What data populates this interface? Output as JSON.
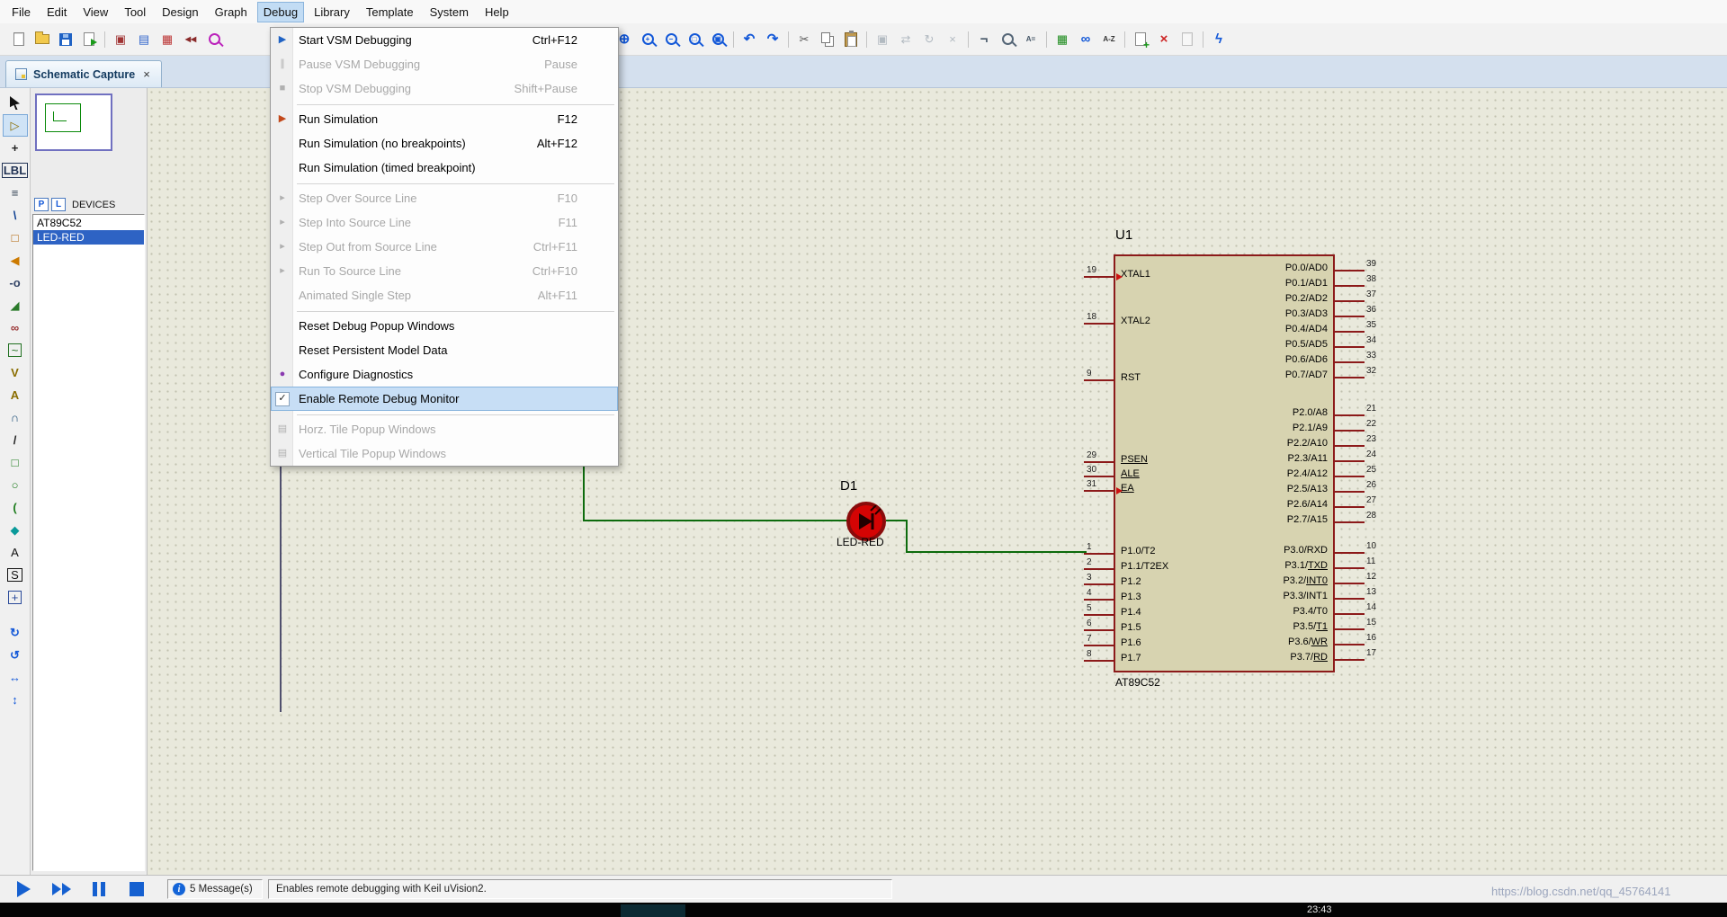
{
  "menu_bar": {
    "items": [
      {
        "label": "File",
        "name": "menu-file"
      },
      {
        "label": "Edit",
        "name": "menu-edit"
      },
      {
        "label": "View",
        "name": "menu-view"
      },
      {
        "label": "Tool",
        "name": "menu-tool"
      },
      {
        "label": "Design",
        "name": "menu-design"
      },
      {
        "label": "Graph",
        "name": "menu-graph"
      },
      {
        "label": "Debug",
        "name": "menu-debug",
        "active": true
      },
      {
        "label": "Library",
        "name": "menu-library"
      },
      {
        "label": "Template",
        "name": "menu-template"
      },
      {
        "label": "System",
        "name": "menu-system"
      },
      {
        "label": "Help",
        "name": "menu-help"
      }
    ]
  },
  "toolbar": {
    "icons": [
      {
        "name": "new-file-icon",
        "kind": "k-page",
        "glyph": ""
      },
      {
        "name": "open-file-icon",
        "kind": "k-folder",
        "glyph": ""
      },
      {
        "name": "save-file-icon",
        "kind": "k-floppy",
        "glyph": ""
      },
      {
        "name": "import-file-icon",
        "kind": "k-page-import",
        "glyph": ""
      },
      {
        "name": "toolbar-separator",
        "sep": true
      },
      {
        "name": "app-window-icon",
        "glyph": "▣",
        "color": "#a03333"
      },
      {
        "name": "tile-windows-icon",
        "glyph": "▤",
        "color": "#3366cc"
      },
      {
        "name": "grid-toggle-icon",
        "glyph": "▦",
        "color": "#bb3333"
      },
      {
        "name": "navigate-back-icon",
        "glyph": "◀◀",
        "color": "#8a2a2a",
        "kind": "k-tiny"
      },
      {
        "name": "zoom-tool-icon",
        "kind": "k-mag",
        "glyph": "",
        "color": "#bb22bb"
      },
      {
        "name": "toolbar-spacer",
        "spacer": true
      },
      {
        "name": "center-at-cursor-icon",
        "glyph": "+",
        "color": "#c89a10",
        "kind": "k-bold"
      },
      {
        "name": "pan-view-icon",
        "glyph": "⊕",
        "color": "#1358d8",
        "kind": "k-bold"
      },
      {
        "name": "zoom-in-icon",
        "kind": "k-mag",
        "glyph": "+",
        "color": "#1358d8"
      },
      {
        "name": "zoom-out-icon",
        "kind": "k-mag",
        "glyph": "−",
        "color": "#1358d8"
      },
      {
        "name": "zoom-area-icon",
        "kind": "k-mag",
        "glyph": "□",
        "color": "#1358d8"
      },
      {
        "name": "zoom-all-icon",
        "kind": "k-mag",
        "glyph": "▣",
        "color": "#1358d8"
      },
      {
        "name": "toolbar-separator",
        "sep": true
      },
      {
        "name": "undo-icon",
        "glyph": "↶",
        "color": "#1358d8",
        "kind": "k-bold"
      },
      {
        "name": "redo-icon",
        "glyph": "↷",
        "color": "#1358d8",
        "kind": "k-bold"
      },
      {
        "name": "toolbar-separator",
        "sep": true
      },
      {
        "name": "cut-icon",
        "glyph": "✂",
        "color": "#555555"
      },
      {
        "name": "copy-icon",
        "kind": "k-copy",
        "glyph": ""
      },
      {
        "name": "paste-icon",
        "kind": "k-paste",
        "glyph": ""
      },
      {
        "name": "toolbar-separator",
        "sep": true
      },
      {
        "name": "block-copy-icon",
        "glyph": "▣",
        "color": "#667788",
        "disabled": true
      },
      {
        "name": "block-move-icon",
        "glyph": "⇄",
        "color": "#667788",
        "disabled": true
      },
      {
        "name": "block-rotate-icon",
        "glyph": "↻",
        "color": "#667788",
        "disabled": true
      },
      {
        "name": "block-delete-icon",
        "glyph": "×",
        "color": "#667788",
        "disabled": true
      },
      {
        "name": "toolbar-separator",
        "sep": true
      },
      {
        "name": "wire-autorouter-icon",
        "glyph": "¬",
        "color": "#445566",
        "kind": "k-bold"
      },
      {
        "name": "search-tag-icon",
        "kind": "k-mag",
        "glyph": "",
        "color": "#556677"
      },
      {
        "name": "property-assignment-icon",
        "glyph": "A=",
        "color": "#445566",
        "kind": "k-tiny"
      },
      {
        "name": "toolbar-separator",
        "sep": true
      },
      {
        "name": "design-grid-icon",
        "glyph": "▦",
        "color": "#1a8a1a"
      },
      {
        "name": "find-component-icon",
        "glyph": "∞",
        "color": "#1358d8",
        "kind": "k-bold"
      },
      {
        "name": "sort-az-icon",
        "glyph": "A-Z",
        "color": "#333333",
        "kind": "k-tiny"
      },
      {
        "name": "toolbar-separator",
        "sep": true
      },
      {
        "name": "new-sheet-icon",
        "kind": "k-page-plus",
        "glyph": ""
      },
      {
        "name": "remove-sheet-icon",
        "glyph": "×",
        "color": "#cc2222",
        "kind": "k-bold"
      },
      {
        "name": "goto-sheet-icon",
        "kind": "k-page",
        "glyph": "",
        "disabled": true
      },
      {
        "name": "toolbar-separator",
        "sep": true
      },
      {
        "name": "electrical-check-icon",
        "glyph": "ϟ",
        "color": "#1358d8",
        "kind": "k-bold"
      }
    ]
  },
  "tab_bar": {
    "label": "Schematic Capture",
    "close_glyph": "×"
  },
  "side_toolbar": {
    "icons": [
      {
        "name": "selection-mode-icon",
        "kind": "k-cursor",
        "glyph": ""
      },
      {
        "name": "component-mode-icon",
        "glyph": "▷",
        "color": "#8a6d00",
        "selected": true
      },
      {
        "name": "junction-dot-mode-icon",
        "glyph": "+",
        "color": "#222222",
        "kind": "k-bold"
      },
      {
        "name": "wire-label-mode-icon",
        "glyph": "LBL",
        "color": "#223355",
        "kind": "k-lbl"
      },
      {
        "name": "text-script-mode-icon",
        "glyph": "≡",
        "color": "#334455"
      },
      {
        "name": "buses-mode-icon",
        "glyph": "\\",
        "color": "#0a3d91",
        "kind": "k-bold"
      },
      {
        "name": "subcircuit-mode-icon",
        "glyph": "□",
        "color": "#b06000"
      },
      {
        "name": "terminal-mode-icon",
        "glyph": "◀",
        "color": "#cc7a00"
      },
      {
        "name": "device-pin-mode-icon",
        "glyph": "-o",
        "color": "#334466",
        "kind": "k-tiny"
      },
      {
        "name": "graph-mode-icon",
        "glyph": "◢",
        "color": "#2a7a2a"
      },
      {
        "name": "tape-recorder-mode-icon",
        "glyph": "∞",
        "color": "#993333",
        "kind": "k-bold"
      },
      {
        "name": "generator-mode-icon",
        "glyph": "~",
        "color": "#207020",
        "kind": "k-boxed"
      },
      {
        "name": "voltage-probe-mode-icon",
        "glyph": "V",
        "color": "#8a6d00",
        "kind": "k-bold"
      },
      {
        "name": "current-probe-mode-icon",
        "glyph": "A",
        "color": "#8a6d00",
        "kind": "k-bold"
      },
      {
        "name": "virtual-instruments-mode-icon",
        "glyph": "∩",
        "color": "#20507a",
        "kind": "k-bold"
      },
      {
        "name": "2d-line-mode-icon",
        "glyph": "/",
        "color": "#222222",
        "kind": "k-bold"
      },
      {
        "name": "2d-box-mode-icon",
        "glyph": "□",
        "color": "#1a7a1a"
      },
      {
        "name": "2d-circle-mode-icon",
        "glyph": "○",
        "color": "#1a7a1a"
      },
      {
        "name": "2d-arc-mode-icon",
        "glyph": "(",
        "color": "#1a7a1a",
        "kind": "k-bold"
      },
      {
        "name": "2d-path-mode-icon",
        "glyph": "◆",
        "color": "#0a9a9a"
      },
      {
        "name": "2d-text-mode-icon",
        "glyph": "A",
        "color": "#111111"
      },
      {
        "name": "2d-symbol-mode-icon",
        "glyph": "S",
        "color": "#111111",
        "kind": "k-boxed"
      },
      {
        "name": "2d-marker-mode-icon",
        "glyph": "+",
        "color": "#2a4a9a",
        "kind": "k-boxed"
      },
      {
        "name": "mode-toolbar-gap",
        "gap": true
      },
      {
        "name": "rotate-clockwise-icon",
        "glyph": "↻",
        "color": "#1358d8",
        "kind": "k-bold"
      },
      {
        "name": "rotate-anticlockwise-icon",
        "glyph": "↺",
        "color": "#1358d8",
        "kind": "k-bold"
      },
      {
        "name": "x-mirror-icon",
        "glyph": "↔",
        "color": "#1358d8",
        "kind": "k-bold"
      },
      {
        "name": "y-mirror-icon",
        "glyph": "↕",
        "color": "#1358d8",
        "kind": "k-bold"
      }
    ]
  },
  "left_panel": {
    "devices": {
      "p_button": "P",
      "l_button": "L",
      "title": "DEVICES",
      "items": [
        {
          "name": "AT89C52"
        },
        {
          "name": "LED-RED",
          "selected": true
        }
      ]
    }
  },
  "debug_menu": {
    "items": [
      {
        "name": "menu-item-start-vsm-debugging",
        "label": "Start VSM Debugging",
        "shortcut": "Ctrl+F12",
        "gicon": "▶",
        "gcls": "mi-play"
      },
      {
        "name": "menu-item-pause-vsm-debugging",
        "label": "Pause VSM Debugging",
        "shortcut": "Pause",
        "gicon": "∥",
        "gcls": "mi-gray",
        "disabled": true
      },
      {
        "name": "menu-item-stop-vsm-debugging",
        "label": "Stop VSM Debugging",
        "shortcut": "Shift+Pause",
        "gicon": "■",
        "gcls": "mi-gray",
        "disabled": true
      },
      {
        "name": "menu-separator",
        "sep": true
      },
      {
        "name": "menu-item-run-simulation",
        "label": "Run Simulation",
        "shortcut": "F12",
        "gicon": "▶",
        "gcls": "mi-run"
      },
      {
        "name": "menu-item-run-simulation-no-breakpoints",
        "label": "Run Simulation (no breakpoints)",
        "shortcut": "Alt+F12"
      },
      {
        "name": "menu-item-run-simulation-timed-breakpoint",
        "label": "Run Simulation (timed breakpoint)",
        "shortcut": ""
      },
      {
        "name": "menu-separator",
        "sep": true
      },
      {
        "name": "menu-item-step-over-source-line",
        "label": "Step Over Source Line",
        "shortcut": "F10",
        "gicon": "▸",
        "gcls": "mi-gray",
        "disabled": true
      },
      {
        "name": "menu-item-step-into-source-line",
        "label": "Step Into Source Line",
        "shortcut": "F11",
        "gicon": "▸",
        "gcls": "mi-gray",
        "disabled": true
      },
      {
        "name": "menu-item-step-out-from-source-line",
        "label": "Step Out from Source Line",
        "shortcut": "Ctrl+F11",
        "gicon": "▸",
        "gcls": "mi-gray",
        "disabled": true
      },
      {
        "name": "menu-item-run-to-source-line",
        "label": "Run To Source Line",
        "shortcut": "Ctrl+F10",
        "gicon": "▸",
        "gcls": "mi-gray",
        "disabled": true
      },
      {
        "name": "menu-item-animated-single-step",
        "label": "Animated Single Step",
        "shortcut": "Alt+F11",
        "disabled": true
      },
      {
        "name": "menu-separator",
        "sep": true
      },
      {
        "name": "menu-item-reset-debug-popup-windows",
        "label": "Reset Debug Popup Windows",
        "shortcut": ""
      },
      {
        "name": "menu-item-reset-persistent-model-data",
        "label": "Reset Persistent Model Data",
        "shortcut": ""
      },
      {
        "name": "menu-item-configure-diagnostics",
        "label": "Configure Diagnostics",
        "shortcut": "",
        "gicon": "●",
        "gcls": "mi-bug"
      },
      {
        "name": "menu-item-enable-remote-debug-monitor",
        "label": "Enable Remote Debug Monitor",
        "shortcut": "",
        "gicon": "✓",
        "gcls": "mi-chk",
        "highlighted": true,
        "checked": true
      },
      {
        "name": "menu-separator",
        "sep": true
      },
      {
        "name": "menu-item-horz-tile-popup-windows",
        "label": "Horz. Tile Popup Windows",
        "shortcut": "",
        "gicon": "▤",
        "gcls": "mi-gray",
        "disabled": true
      },
      {
        "name": "menu-item-vertical-tile-popup-windows",
        "label": "Vertical Tile Popup Windows",
        "shortcut": "",
        "gicon": "▤",
        "gcls": "mi-gray",
        "disabled": true
      }
    ]
  },
  "schematic": {
    "chip": {
      "ref": "U1",
      "part": "AT89C52",
      "groups": {
        "xtal": [
          {
            "num": "19",
            "pre": "XTAL1",
            "bar": ""
          },
          {
            "num": "18",
            "pre": "XTAL2",
            "bar": ""
          }
        ],
        "rst": [
          {
            "num": "9",
            "pre": "RST",
            "bar": ""
          }
        ],
        "ctrl": [
          {
            "num": "29",
            "pre": "",
            "bar": "PSEN"
          },
          {
            "num": "30",
            "pre": "",
            "bar": "ALE"
          },
          {
            "num": "31",
            "pre": "",
            "bar": "EA"
          }
        ],
        "p1": [
          {
            "num": "1",
            "pre": "P1.0/T2",
            "bar": ""
          },
          {
            "num": "2",
            "pre": "P1.1/T2EX",
            "bar": ""
          },
          {
            "num": "3",
            "pre": "P1.2",
            "bar": ""
          },
          {
            "num": "4",
            "pre": "P1.3",
            "bar": ""
          },
          {
            "num": "5",
            "pre": "P1.4",
            "bar": ""
          },
          {
            "num": "6",
            "pre": "P1.5",
            "bar": ""
          },
          {
            "num": "7",
            "pre": "P1.6",
            "bar": ""
          },
          {
            "num": "8",
            "pre": "P1.7",
            "bar": ""
          }
        ],
        "p0": [
          {
            "num": "39",
            "pre": "P0.0/AD0",
            "bar": ""
          },
          {
            "num": "38",
            "pre": "P0.1/AD1",
            "bar": ""
          },
          {
            "num": "37",
            "pre": "P0.2/AD2",
            "bar": ""
          },
          {
            "num": "36",
            "pre": "P0.3/AD3",
            "bar": ""
          },
          {
            "num": "35",
            "pre": "P0.4/AD4",
            "bar": ""
          },
          {
            "num": "34",
            "pre": "P0.5/AD5",
            "bar": ""
          },
          {
            "num": "33",
            "pre": "P0.6/AD6",
            "bar": ""
          },
          {
            "num": "32",
            "pre": "P0.7/AD7",
            "bar": ""
          }
        ],
        "p2": [
          {
            "num": "21",
            "pre": "P2.0/A8",
            "bar": ""
          },
          {
            "num": "22",
            "pre": "P2.1/A9",
            "bar": ""
          },
          {
            "num": "23",
            "pre": "P2.2/A10",
            "bar": ""
          },
          {
            "num": "24",
            "pre": "P2.3/A11",
            "bar": ""
          },
          {
            "num": "25",
            "pre": "P2.4/A12",
            "bar": ""
          },
          {
            "num": "26",
            "pre": "P2.5/A13",
            "bar": ""
          },
          {
            "num": "27",
            "pre": "P2.6/A14",
            "bar": ""
          },
          {
            "num": "28",
            "pre": "P2.7/A15",
            "bar": ""
          }
        ],
        "p3": [
          {
            "num": "10",
            "pre": "P3.0/RXD",
            "bar": ""
          },
          {
            "num": "11",
            "pre": "P3.1/",
            "bar": "TXD"
          },
          {
            "num": "12",
            "pre": "P3.2/",
            "bar": "INT0"
          },
          {
            "num": "13",
            "pre": "P3.3/INT1",
            "bar": ""
          },
          {
            "num": "14",
            "pre": "P3.4/T0",
            "bar": ""
          },
          {
            "num": "15",
            "pre": "P3.5/",
            "bar": "T1"
          },
          {
            "num": "16",
            "pre": "P3.6/",
            "bar": "WR"
          },
          {
            "num": "17",
            "pre": "P3.7/",
            "bar": "RD"
          }
        ]
      }
    },
    "led": {
      "ref": "D1",
      "part": "LED-RED"
    }
  },
  "status_bar": {
    "message_count": "5 Message(s)",
    "info_glyph": "i",
    "hint": "Enables remote debugging with Keil uVision2."
  },
  "taskbar": {
    "time": "23:43"
  },
  "watermark": "https://blog.csdn.net/qq_45764141",
  "colors": {
    "accent": "#1358d8",
    "wire_green": "#0d6b0d",
    "component_border": "#8c1a1a",
    "selection_blue": "#2e63c4",
    "menu_highlight": "#c7def5"
  }
}
